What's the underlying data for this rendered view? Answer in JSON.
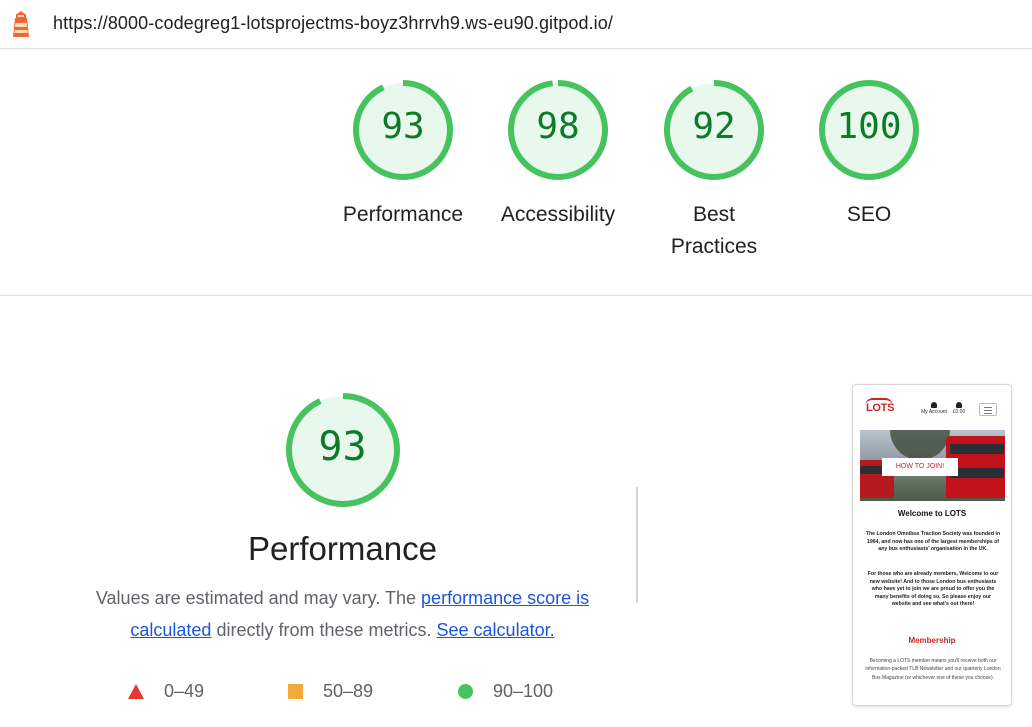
{
  "address_bar": {
    "url": "https://8000-codegreg1-lotsprojectms-boyz3hrrvh9.ws-eu90.gitpod.io/",
    "icon": "lighthouse-icon"
  },
  "summary_scores": [
    {
      "label": "Performance",
      "score": 93
    },
    {
      "label": "Accessibility",
      "score": 98
    },
    {
      "label": "Best Practices",
      "score": 92
    },
    {
      "label": "SEO",
      "score": 100
    }
  ],
  "performance": {
    "score": 93,
    "title": "Performance",
    "desc_prefix": "Values are estimated and may vary. The ",
    "link_score": "performance score is calculated",
    "desc_middle": " directly from these metrics. ",
    "link_calc": "See calculator."
  },
  "legend": [
    {
      "range": "0–49",
      "icon": "triangle-icon",
      "color": "#e53935"
    },
    {
      "range": "50–89",
      "icon": "square-icon",
      "color": "#f4a93d"
    },
    {
      "range": "90–100",
      "icon": "circle-icon",
      "color": "#46c35f"
    }
  ],
  "thumbnail": {
    "logo": "LOTS",
    "account": "My Account",
    "bag_total": "£0.00",
    "hero_button": "HOW TO JOIN!",
    "heading": "Welcome to LOTS",
    "para1": "The London Omnibus Traction Society was founded in 1964, and now has one of the largest memberships of any bus enthusiasts' organisation in the UK.",
    "para2": "For those who are already members, Welcome to our new website! And to those London bus enthusiasts who have yet to join we are proud to offer you the many benefits of doing so. So please enjoy our website and see what's out there!",
    "membership_heading": "Membership",
    "para3": "Becoming a LOTS member means you'll receive both our information-packed TLB Newsletter and our quarterly London Bus Magazine (or whichever one of these you choose)."
  },
  "colors": {
    "pass": "#0c7a28",
    "pass_ring": "#46c35f",
    "pass_fill": "#e9f8ec",
    "link": "#1a56db"
  }
}
